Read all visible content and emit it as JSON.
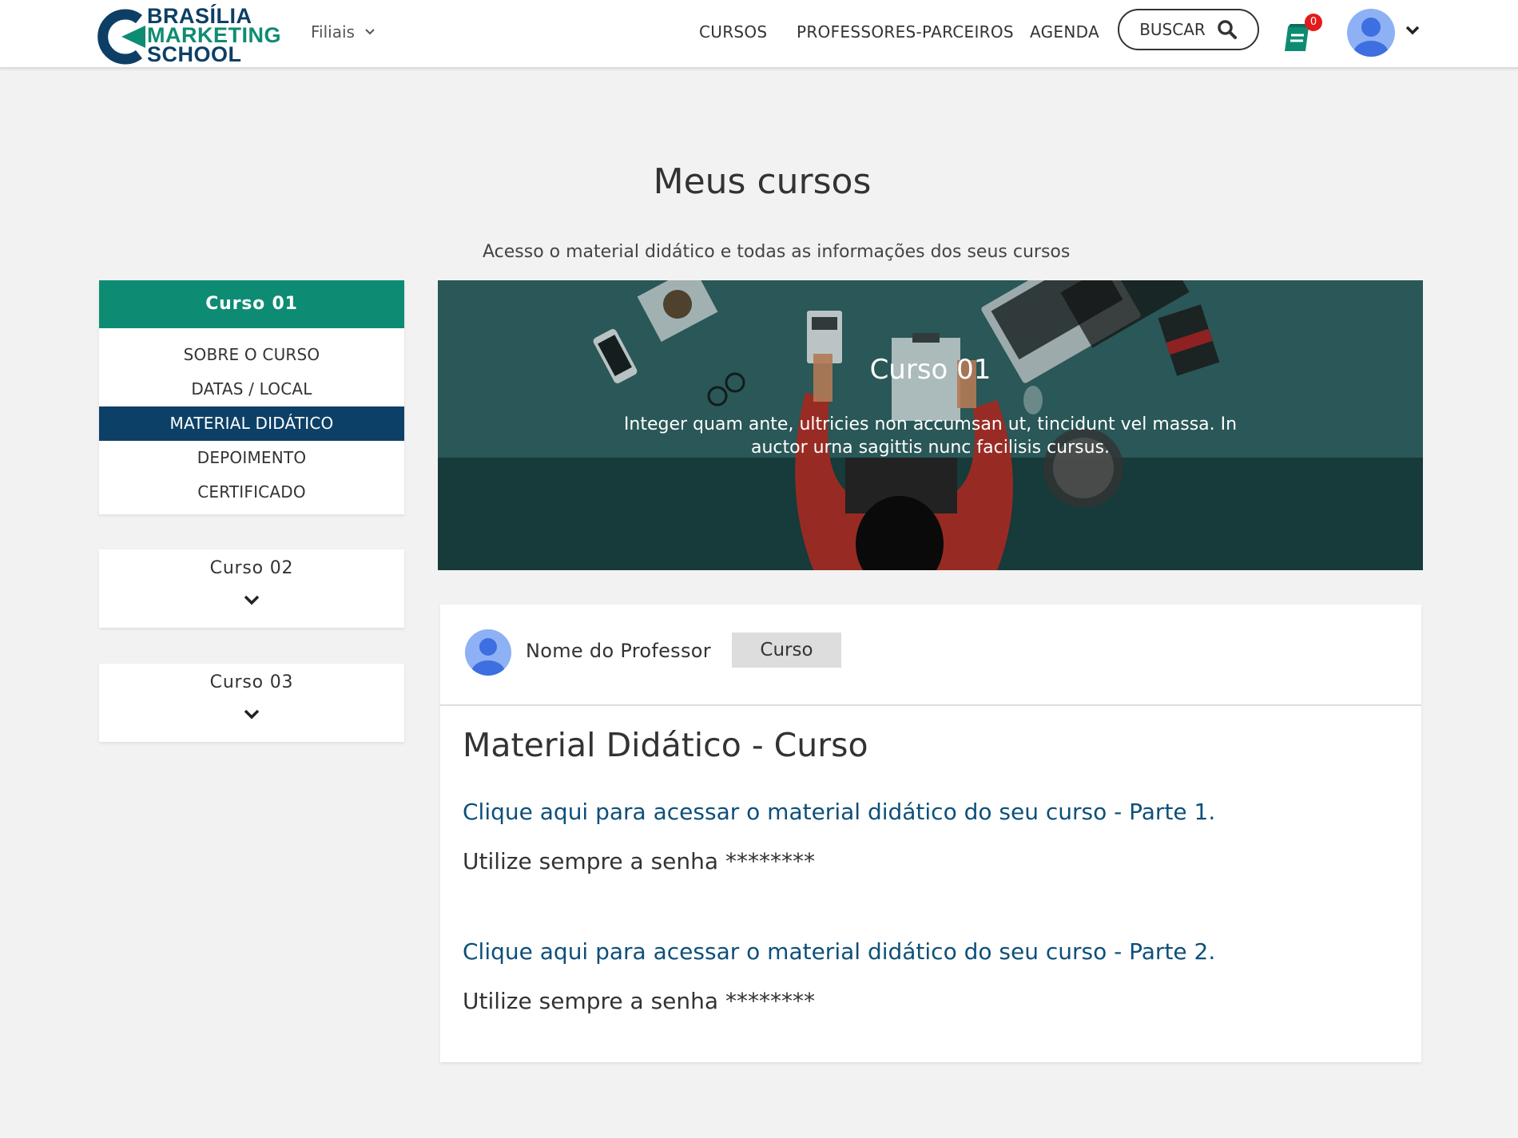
{
  "header": {
    "logo": {
      "line1": "BRASÍLIA",
      "line2": "MARKETING",
      "line3": "SCHOOL"
    },
    "filiais_label": "Filiais",
    "nav": {
      "cursos": "CURSOS",
      "professores": "PROFESSORES-PARCEIROS",
      "agenda": "AGENDA"
    },
    "search_label": "BUSCAR",
    "cart_count": "0"
  },
  "page": {
    "title": "Meus cursos",
    "subtitle": "Acesso o material didático e todas as informações dos seus cursos"
  },
  "sidebar": {
    "active_course": "Curso 01",
    "menu": [
      "SOBRE O CURSO",
      "DATAS / LOCAL",
      "MATERIAL DIDÁTICO",
      "DEPOIMENTO",
      "CERTIFICADO"
    ],
    "active_menu_index": 2,
    "other_courses": [
      "Curso 02",
      "Curso 03"
    ]
  },
  "hero": {
    "title": "Curso 01",
    "description": "Integer quam ante, ultricies non accumsan ut, tincidunt vel massa. In auctor urna sagittis nunc facilisis cursus."
  },
  "content": {
    "professor_name": "Nome do Professor",
    "tag": "Curso",
    "section_title": "Material Didático - Curso",
    "links": [
      {
        "text": "Clique aqui para acessar o material didático do seu curso - Parte 1.",
        "note": "Utilize sempre a senha ********"
      },
      {
        "text": "Clique aqui para acessar o material didático do seu curso - Parte 2.",
        "note": "Utilize sempre a senha ********"
      }
    ]
  },
  "colors": {
    "brand_green": "#0e8c73",
    "brand_navy": "#0d4066",
    "link": "#0d4f7a",
    "badge": "#e31b1b",
    "avatar": "#5d8ef0"
  }
}
